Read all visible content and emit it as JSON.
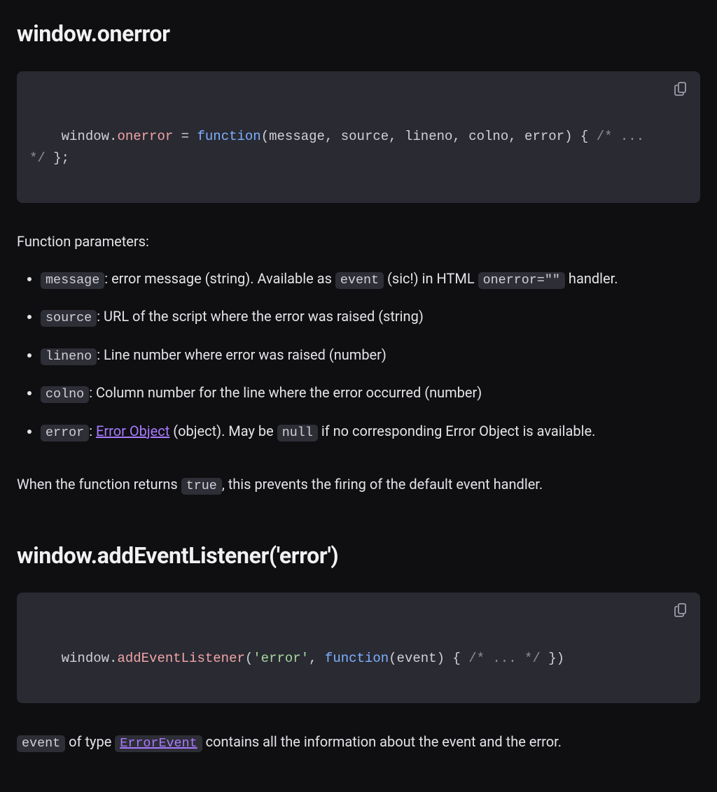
{
  "section1": {
    "title": "window.onerror",
    "code": {
      "t_window": "window",
      "t_dot": ".",
      "t_prop": "onerror",
      "t_eq": " = ",
      "t_kw": "function",
      "t_open": "(",
      "t_p1": "message",
      "t_c1": ", ",
      "t_p2": "source",
      "t_c2": ", ",
      "t_p3": "lineno",
      "t_c3": ", ",
      "t_p4": "colno",
      "t_c4": ", ",
      "t_p5": "error",
      "t_close": ")",
      "t_brace": " { ",
      "t_cmt": "/* ... */",
      "t_end": " };"
    },
    "params_intro": "Function parameters:",
    "params": [
      {
        "name": "message",
        "pre": ": error message (string). Available as ",
        "inline1": "event",
        "mid": " (sic!) in HTML ",
        "inline2": "onerror=\"\"",
        "post": " handler."
      },
      {
        "name": "source",
        "pre": ": URL of the script where the error was raised (string)"
      },
      {
        "name": "lineno",
        "pre": ": Line number where error was raised (number)"
      },
      {
        "name": "colno",
        "pre": ": Column number for the line where the error occurred (number)"
      },
      {
        "name": "error",
        "pre": ": ",
        "link_text": "Error Object",
        "mid": " (object). May be ",
        "inline1": "null",
        "post": " if no corresponding Error Object is available."
      }
    ],
    "return_para_pre": "When the function returns ",
    "return_inline": "true",
    "return_para_post": ", this prevents the firing of the default event handler."
  },
  "section2": {
    "title": "window.addEventListener('error')",
    "code": {
      "t_window": "window",
      "t_dot": ".",
      "t_prop": "addEventListener",
      "t_open": "(",
      "t_str": "'error'",
      "t_c1": ", ",
      "t_kw": "function",
      "t_open2": "(",
      "t_p1": "event",
      "t_close2": ")",
      "t_brace": " { ",
      "t_cmt": "/* ... */",
      "t_end": " })"
    },
    "tail_inline1": "event",
    "tail_mid1": " of type ",
    "tail_link": "ErrorEvent",
    "tail_post": " contains all the information about the event and the error."
  }
}
